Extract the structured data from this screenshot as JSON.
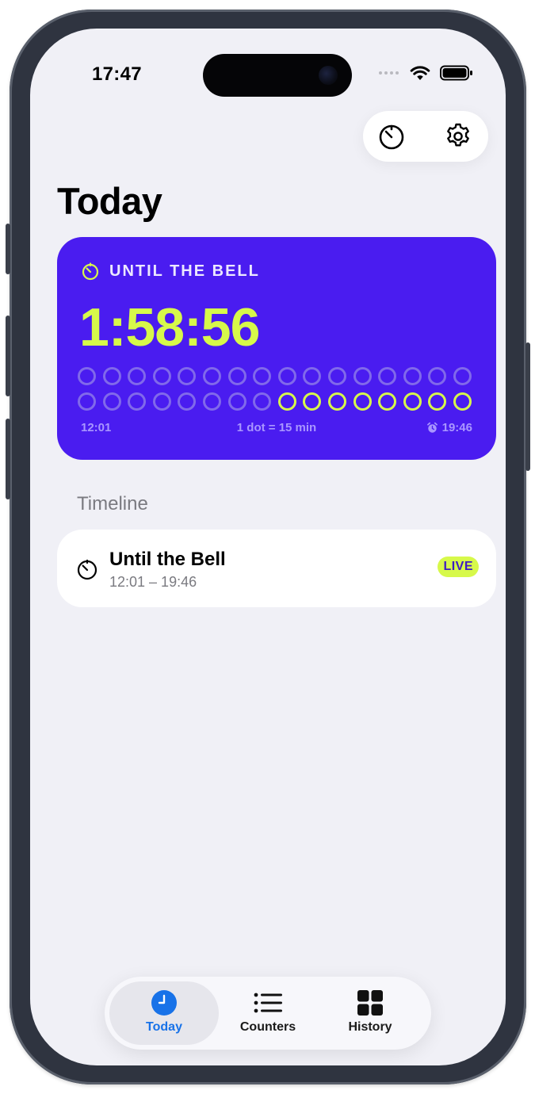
{
  "status": {
    "time": "17:47"
  },
  "colors": {
    "hero_bg": "#4a1cf0",
    "accent_lime": "#d7f94a",
    "tab_active": "#1872e8",
    "screen_bg": "#f0f0f6"
  },
  "top_actions": {
    "timer_icon": "stopwatch-icon",
    "settings_icon": "gear-icon"
  },
  "page": {
    "title": "Today"
  },
  "hero": {
    "label": "UNTIL THE BELL",
    "countdown": "1:58:56",
    "start": "12:01",
    "legend": "1 dot = 15 min",
    "end": "19:46",
    "dots_total": 32,
    "dots_remaining": 8
  },
  "timeline": {
    "section_label": "Timeline",
    "items": [
      {
        "title": "Until the Bell",
        "time_range": "12:01 – 19:46",
        "badge": "LIVE"
      }
    ]
  },
  "tabbar": {
    "tabs": [
      {
        "label": "Today",
        "icon": "clock-icon",
        "active": true
      },
      {
        "label": "Counters",
        "icon": "list-icon",
        "active": false
      },
      {
        "label": "History",
        "icon": "grid-icon",
        "active": false
      }
    ]
  }
}
